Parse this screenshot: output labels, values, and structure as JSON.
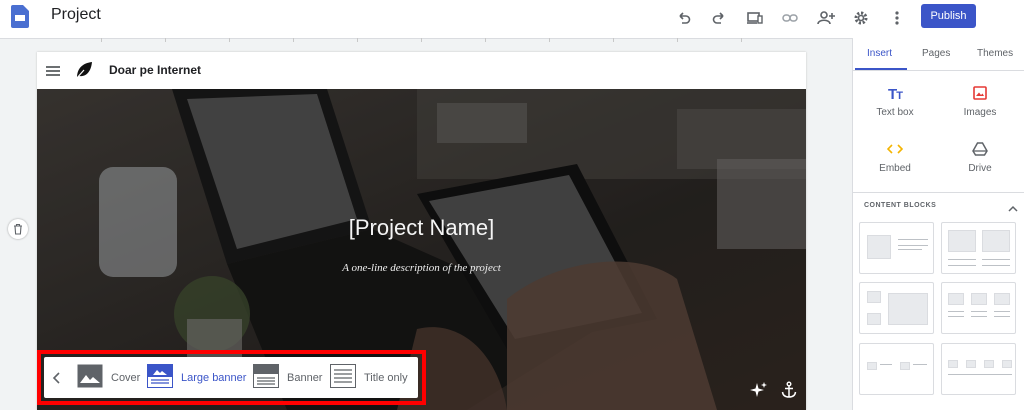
{
  "app": {
    "title": "Project"
  },
  "toolbar": {
    "publish_label": "Publish",
    "icons": [
      "undo-icon",
      "redo-icon",
      "preview-icon",
      "link-icon",
      "share-icon",
      "settings-icon",
      "more-icon"
    ]
  },
  "site": {
    "name": "Doar pe Internet",
    "hero_title": "[Project Name]",
    "hero_subtitle": "A one-line description of the project"
  },
  "layout_bar": {
    "options": [
      {
        "label": "Cover",
        "selected": false
      },
      {
        "label": "Large banner",
        "selected": true
      },
      {
        "label": "Banner",
        "selected": false
      },
      {
        "label": "Title only",
        "selected": false
      }
    ]
  },
  "panel": {
    "tabs": [
      "Insert",
      "Pages",
      "Themes"
    ],
    "active_tab": "Insert",
    "insert_items": [
      {
        "label": "Text box",
        "icon": "text-box-icon"
      },
      {
        "label": "Images",
        "icon": "images-icon"
      },
      {
        "label": "Embed",
        "icon": "embed-icon"
      },
      {
        "label": "Drive",
        "icon": "drive-icon"
      }
    ],
    "content_blocks_label": "CONTENT BLOCKS"
  },
  "colors": {
    "accent": "#3b55c8",
    "highlight": "#ff0000",
    "images_icon": "#e53935",
    "embed_icon": "#f4b400"
  }
}
